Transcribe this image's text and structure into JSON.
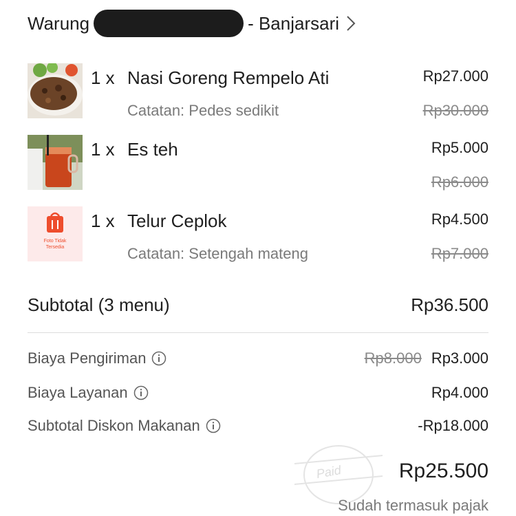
{
  "header": {
    "prefix": "Warung",
    "suffix": "- Banjarsari"
  },
  "items": [
    {
      "qty": "1 x",
      "name": "Nasi Goreng Rempelo Ati",
      "note": "Catatan: Pedes sedikit",
      "price": "Rp27.000",
      "original_price": "Rp30.000"
    },
    {
      "qty": "1 x",
      "name": "Es teh",
      "note": "",
      "price": "Rp5.000",
      "original_price": "Rp6.000"
    },
    {
      "qty": "1 x",
      "name": "Telur Ceplok",
      "note": "Catatan: Setengah mateng",
      "price": "Rp4.500",
      "original_price": "Rp7.000",
      "placeholder_text_1": "Foto Tidak",
      "placeholder_text_2": "Tersedia"
    }
  ],
  "subtotal": {
    "label": "Subtotal (3 menu)",
    "value": "Rp36.500"
  },
  "fees": [
    {
      "label": "Biaya Pengiriman",
      "original": "Rp8.000",
      "value": "Rp3.000"
    },
    {
      "label": "Biaya Layanan",
      "value": "Rp4.000"
    },
    {
      "label": "Subtotal Diskon Makanan",
      "value": "-Rp18.000"
    }
  ],
  "total": {
    "value": "Rp25.500",
    "tax_note": "Sudah termasuk pajak",
    "stamp_text": "Paid"
  },
  "colors": {
    "text": "#1f1f1f",
    "muted": "#7a7a7a",
    "placeholder_bg": "#fdeaea",
    "placeholder_icon": "#ee4d2d"
  }
}
